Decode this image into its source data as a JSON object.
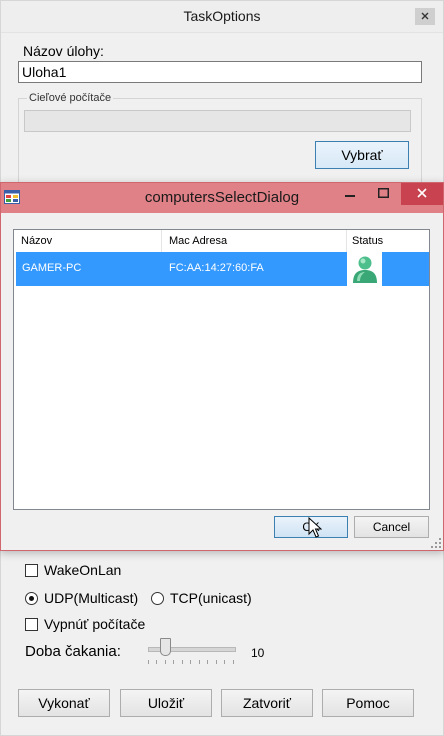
{
  "task_window": {
    "title": "TaskOptions",
    "name_label": "Názov úlohy:",
    "name_value": "Uloha1",
    "targets_group_label": "Cieľové počítače",
    "select_button": "Vybrať",
    "wake_on_lan": {
      "label": "WakeOnLan",
      "checked": false
    },
    "protocol": {
      "options": [
        "UDP(Multicast)",
        "TCP(unicast)"
      ],
      "selected": "UDP(Multicast)"
    },
    "shutdown": {
      "label": "Vypnúť počítače",
      "checked": false
    },
    "wait_label": "Doba čakania:",
    "wait_value": "10",
    "buttons": {
      "run": "Vykonať",
      "save": "Uložiť",
      "close": "Zatvoriť",
      "help": "Pomoc"
    }
  },
  "dialog": {
    "title": "computersSelectDialog",
    "columns": [
      "Názov",
      "Mac Adresa",
      "Status"
    ],
    "rows": [
      {
        "name": "GAMER-PC",
        "mac": "FC:AA:14:27:60:FA",
        "status_icon": "user-online-icon",
        "selected": true
      }
    ],
    "ok_button": "OK",
    "cancel_button": "Cancel"
  },
  "colors": {
    "dialog_titlebar": "#e08087",
    "dialog_close": "#c9424f",
    "selection": "#3399ff",
    "status_icon": "#4dbf8c"
  }
}
